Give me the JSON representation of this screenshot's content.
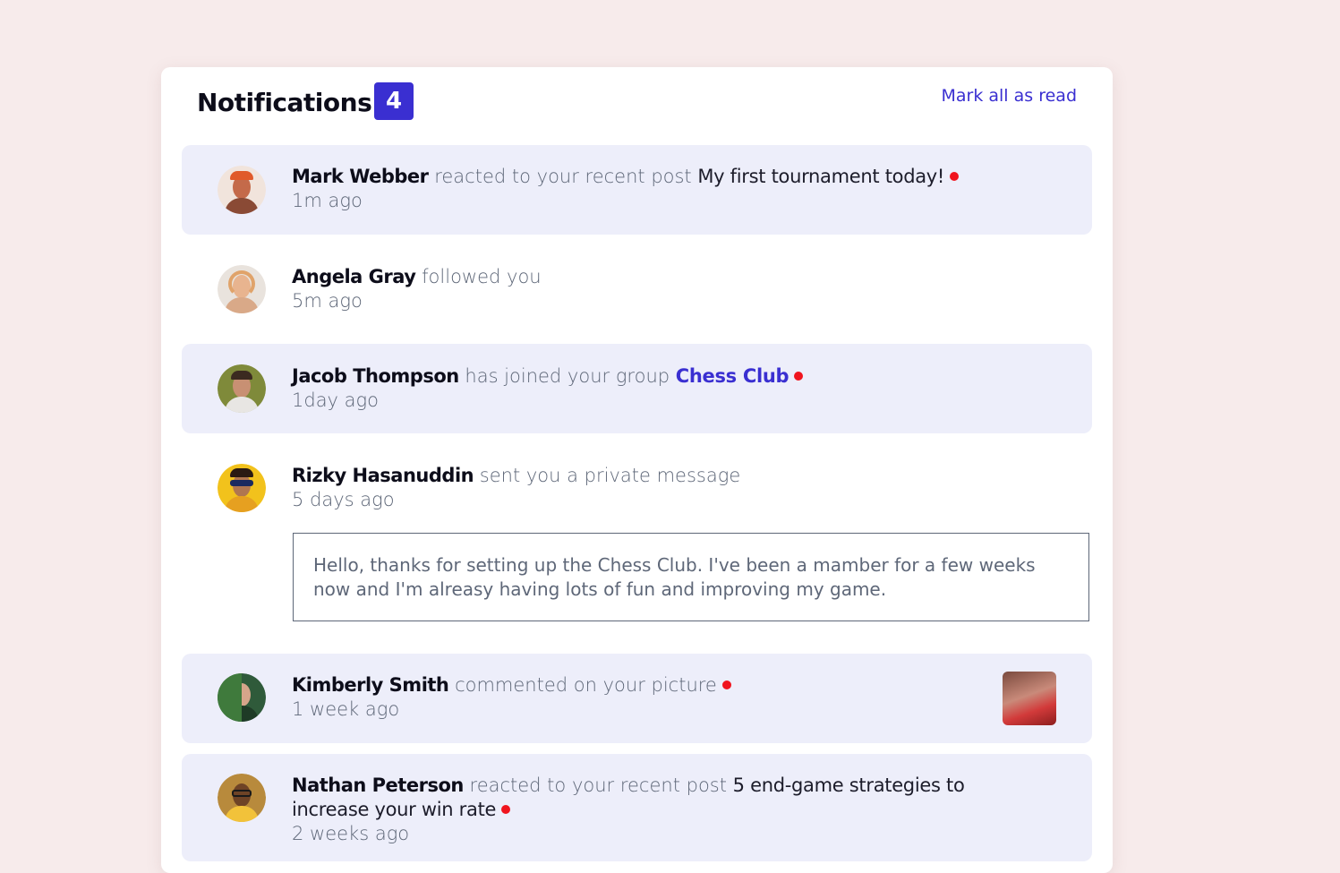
{
  "header": {
    "title": "Notifications",
    "unread_count": "4",
    "mark_all_label": "Mark all as read"
  },
  "colors": {
    "accent": "#3a2fd1",
    "unread_bg": "#edeefa",
    "dot": "#f0141e",
    "page_bg": "#f7ebeb"
  },
  "notifications": [
    {
      "name": "Mark Webber",
      "action": "reacted to your recent post",
      "target": "My first tournament today!",
      "time": "1m ago",
      "unread": true
    },
    {
      "name": "Angela Gray",
      "action": "followed you",
      "target": "",
      "time": "5m ago",
      "unread": false
    },
    {
      "name": "Jacob Thompson",
      "action": "has joined your group",
      "target": "Chess Club",
      "time": "1day ago",
      "unread": true
    },
    {
      "name": "Rizky Hasanuddin",
      "action": "sent you a private message",
      "target": "",
      "time": "5 days ago",
      "unread": false,
      "message": "Hello, thanks for setting up the Chess Club. I've been a mamber for a few weeks now and I'm alreasy having lots of fun and improving my game."
    },
    {
      "name": "Kimberly Smith",
      "action": "commented on your picture",
      "target": "",
      "time": "1 week ago",
      "unread": true
    },
    {
      "name": "Nathan Peterson",
      "action": "reacted to your recent post",
      "target": "5 end-game strategies to increase your win rate",
      "time": "2 weeks ago",
      "unread": true
    }
  ]
}
